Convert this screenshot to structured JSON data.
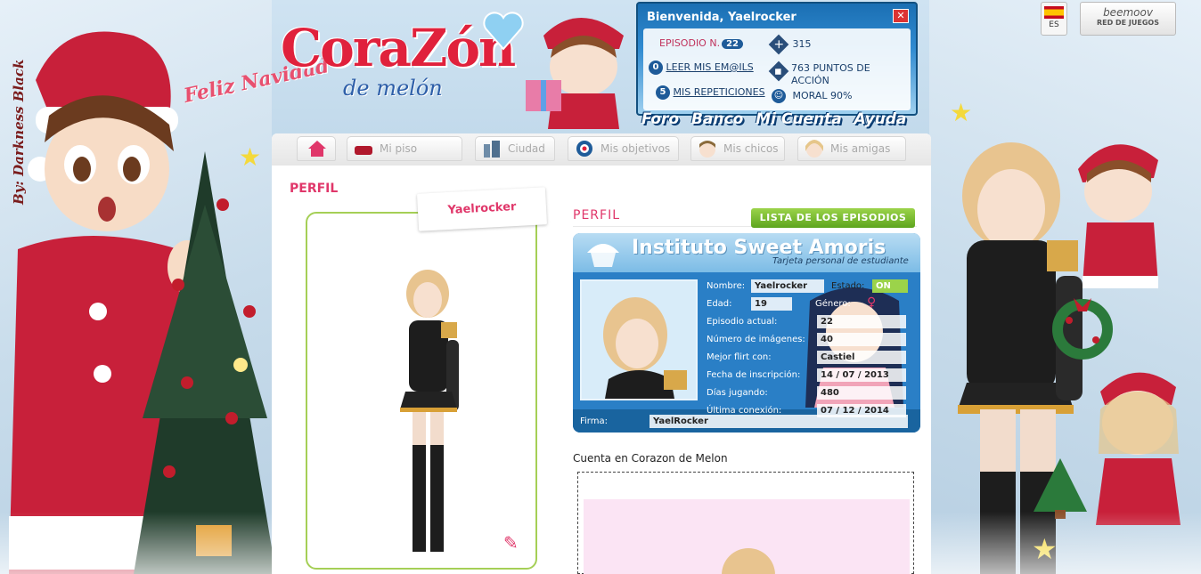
{
  "signature": "By: Darkness Black",
  "logo": {
    "greeting": "Feliz Navidad",
    "title": "CoraZón",
    "subtitle": "de melón"
  },
  "infobox": {
    "welcome": "Bienvenida, Yaelrocker",
    "close_label": "✕",
    "episode_label": "EPISODIO N.",
    "episode_number": "22",
    "dollars": "315",
    "emails_count": "0",
    "emails_label": "LEER MIS EM@ILS",
    "action_points": "763 PUNTOS DE ACCIÓN",
    "repetitions_count": "5",
    "repetitions_label": "MIS REPETICIONES",
    "moral": "MORAL 90%"
  },
  "topnav": [
    "Foro",
    "Banco",
    "Mi Cuenta",
    "Ayuda"
  ],
  "lang": {
    "code": "ES"
  },
  "beemoov": {
    "brand": "beemoov",
    "tagline": "RED DE JUEGOS"
  },
  "tabs": [
    {
      "label": ""
    },
    {
      "label": "Mi piso"
    },
    {
      "label": "Ciudad"
    },
    {
      "label": "Mis objetivos"
    },
    {
      "label": "Mis chicos"
    },
    {
      "label": "Mis amigas"
    }
  ],
  "profile": {
    "section_title": "PERFIL",
    "name_tag": "Yaelrocker",
    "sub_title": "PERFIL",
    "episodes_button": "LISTA DE LOS EPISODIOS",
    "account_label": "Cuenta en Corazon de Melon"
  },
  "idcard": {
    "title": "Instituto Sweet Amoris",
    "subtitle": "Tarjeta personal de estudiante",
    "fields": [
      {
        "label": "Nombre:",
        "value": "Yaelrocker"
      },
      {
        "label": "Edad:",
        "value": "19"
      },
      {
        "label": "Episodio actual:",
        "value": "22"
      },
      {
        "label": "Número de imágenes:",
        "value": "40"
      },
      {
        "label": "Mejor flirt con:",
        "value": "Castiel"
      },
      {
        "label": "Fecha de inscripción:",
        "value": "14 / 07 / 2013"
      },
      {
        "label": "Días jugando:",
        "value": "480"
      },
      {
        "label": "Última conexión:",
        "value": "07 / 12 / 2014"
      }
    ],
    "estado_label": "Estado:",
    "estado_value": "ON",
    "genero_label": "Género:",
    "firma_label": "Firma:",
    "firma_value": "YaelRocker"
  },
  "colors": {
    "accent_pink": "#e0376a",
    "green_border": "#a5cf56",
    "card_blue": "#2a7fc6"
  }
}
